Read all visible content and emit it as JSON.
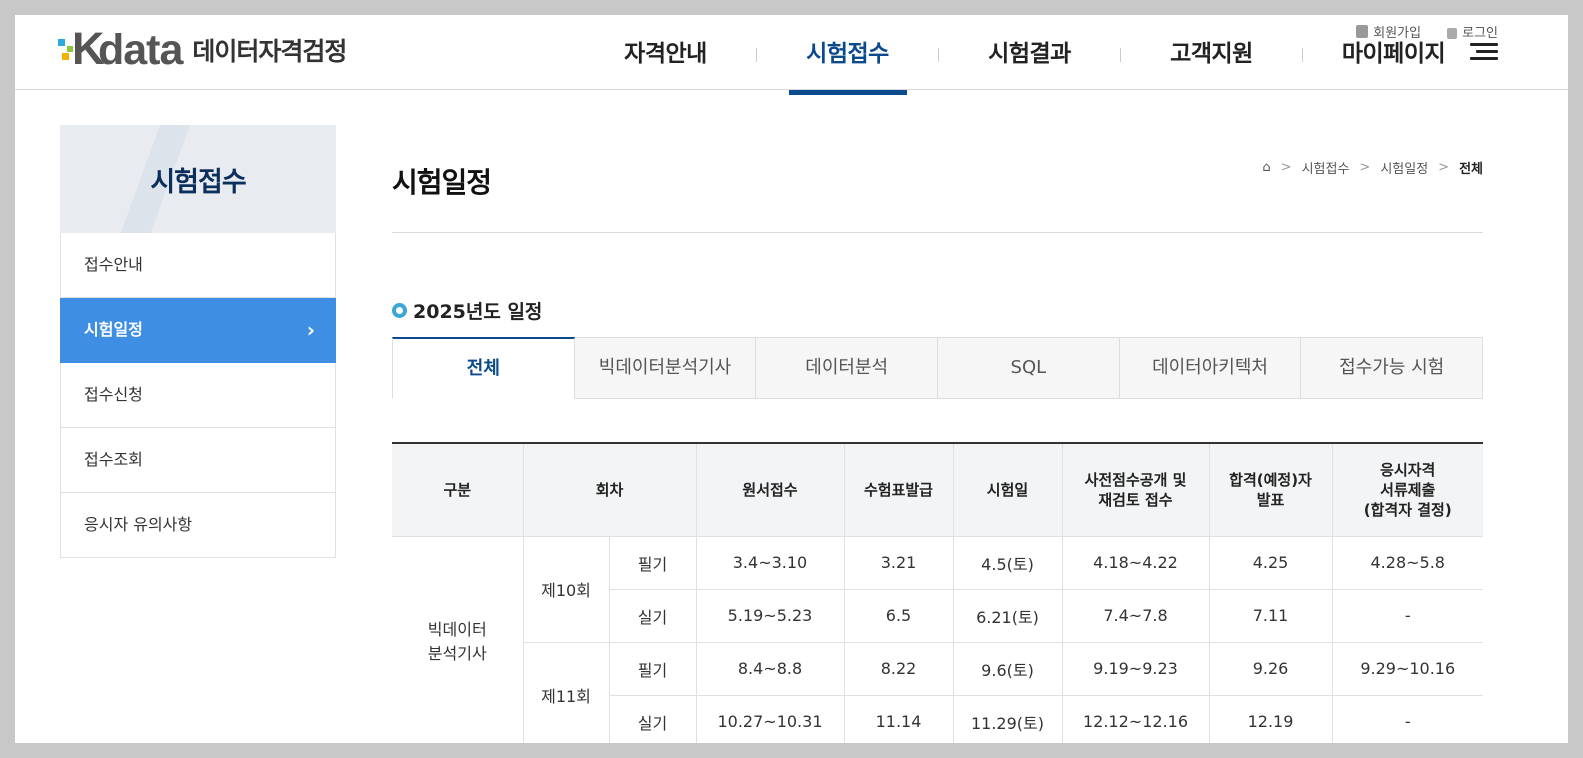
{
  "header": {
    "logo_text": "data",
    "logo_kr": "데이터자격검정",
    "util": [
      "회원가입",
      "로그인"
    ],
    "menu": [
      "자격안내",
      "시험접수",
      "시험결과",
      "고객지원",
      "마이페이지"
    ],
    "active_menu": "시험접수"
  },
  "sidebar": {
    "title": "시험접수",
    "items": [
      "접수안내",
      "시험일정",
      "접수신청",
      "접수조회",
      "응시자 유의사항"
    ],
    "active": "시험일정"
  },
  "main": {
    "title": "시험일정",
    "breadcrumb": [
      "시험접수",
      "시험일정",
      "전체"
    ],
    "section_title": "2025년도 일정",
    "tabs": [
      "전체",
      "빅데이터분석기사",
      "데이터분석",
      "SQL",
      "데이터아키텍처",
      "접수가능 시험"
    ],
    "table": {
      "headers": [
        "구분",
        "회차",
        "원서접수",
        "수험표발급",
        "시험일",
        "사전점수공개 및\n재검토 접수",
        "합격(예정)자\n발표",
        "응시자격\n서류제출\n(합격자 결정)"
      ],
      "category": "빅데이터\n분석기사",
      "rounds": [
        {
          "name": "제10회",
          "rows": [
            {
              "type": "필기",
              "apply": "3.4~3.10",
              "ticket": "3.21",
              "exam": "4.5(토)",
              "review": "4.18~4.22",
              "result": "4.25",
              "docs": "4.28~5.8"
            },
            {
              "type": "실기",
              "apply": "5.19~5.23",
              "ticket": "6.5",
              "exam": "6.21(토)",
              "review": "7.4~7.8",
              "result": "7.11",
              "docs": "-"
            }
          ]
        },
        {
          "name": "제11회",
          "rows": [
            {
              "type": "필기",
              "apply": "8.4~8.8",
              "ticket": "8.22",
              "exam": "9.6(토)",
              "review": "9.19~9.23",
              "result": "9.26",
              "docs": "9.29~10.16"
            },
            {
              "type": "실기",
              "apply": "10.27~10.31",
              "ticket": "11.14",
              "exam": "11.29(토)",
              "review": "12.12~12.16",
              "result": "12.19",
              "docs": "-"
            }
          ]
        }
      ]
    }
  }
}
